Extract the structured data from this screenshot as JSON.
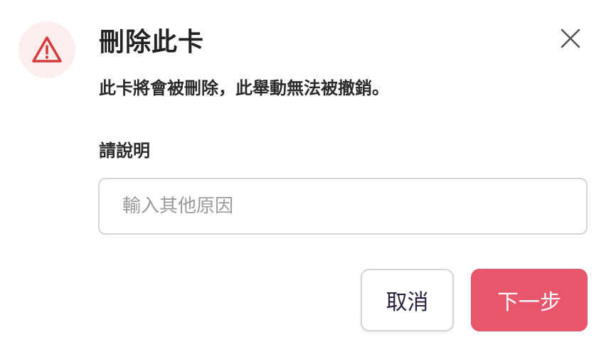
{
  "dialog": {
    "title": "刪除此卡",
    "description": "此卡將會被刪除，此舉動無法被撤銷。",
    "field_label": "請說明",
    "reason_placeholder": "輸入其他原因",
    "reason_value": "",
    "cancel_label": "取消",
    "next_label": "下一步"
  },
  "icons": {
    "warning": "warning-triangle-icon",
    "close": "close-icon"
  },
  "colors": {
    "warning_red": "#d63c3c",
    "warning_bg": "#fdeeee",
    "primary_button": "#e8566c",
    "title_text": "#222222",
    "cancel_text": "#2b1f3f"
  }
}
